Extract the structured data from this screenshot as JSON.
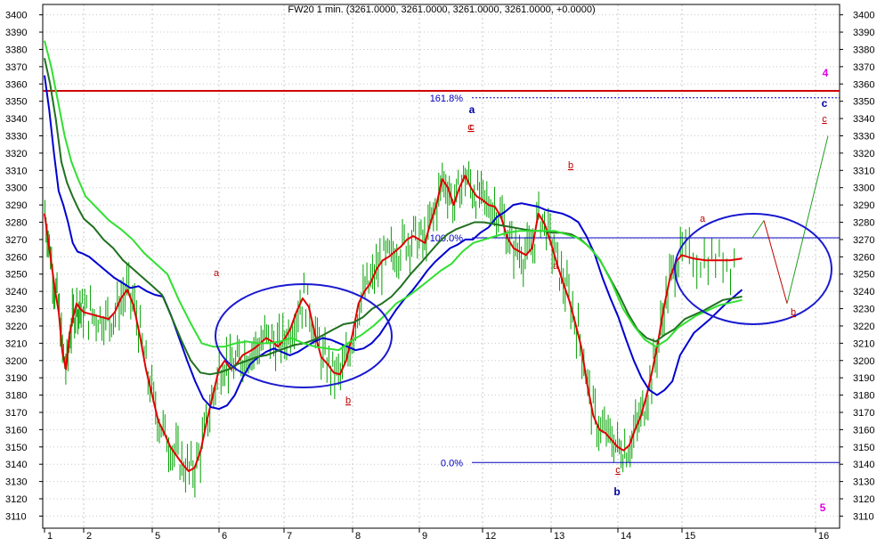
{
  "chart_data": {
    "type": "line",
    "title": "FW20 1 min. (3261.0000, 3261.0000, 3261.0000, 3261.0000, +0.0000)",
    "xlabel": "",
    "ylabel": "",
    "ylim": [
      3103,
      3406
    ],
    "y_ticks": [
      3110,
      3120,
      3130,
      3140,
      3150,
      3160,
      3170,
      3180,
      3190,
      3200,
      3210,
      3220,
      3230,
      3240,
      3250,
      3260,
      3270,
      3280,
      3290,
      3300,
      3310,
      3320,
      3330,
      3340,
      3350,
      3360,
      3370,
      3380,
      3390,
      3400
    ],
    "x_day_ticks": [
      "1",
      "2",
      "5",
      "6",
      "7",
      "8",
      "9",
      "12",
      "13",
      "14",
      "15",
      "16"
    ],
    "grid": true,
    "colors": {
      "price_bars": "#00a000",
      "fast_ma": "#e00000",
      "mid_ma": "#0000d0",
      "slow_ma_dark": "#207020",
      "slow_ma_light": "#30e030",
      "resistance": "#d00000",
      "fib": "#0000c0",
      "wave_red": "#c00000",
      "wave_blue": "#0000a0",
      "wave_magenta": "#e000e0"
    },
    "resistance_level": 3356,
    "fibonacci": [
      {
        "label": "161.8%",
        "value": 3352,
        "style": "dashed"
      },
      {
        "label": "100.0%",
        "value": 3271,
        "style": "solid"
      },
      {
        "label": "0.0%",
        "value": 3141,
        "style": "solid"
      }
    ],
    "series": [
      {
        "values": [
          3285,
          3270,
          3255,
          3240,
          3228,
          3205,
          3195,
          3215,
          3225,
          3233,
          3230,
          3228,
          3227,
          3226,
          3225,
          3224,
          3228,
          3236,
          3241,
          3232,
          3215,
          3195,
          3180,
          3165,
          3158,
          3150,
          3145,
          3140,
          3136,
          3138,
          3148,
          3165,
          3180,
          3195,
          3200,
          3195,
          3198,
          3203,
          3205,
          3207,
          3210,
          3213,
          3211,
          3208,
          3212,
          3218,
          3228,
          3236,
          3231,
          3215,
          3202,
          3198,
          3193,
          3192,
          3200,
          3215,
          3233,
          3240,
          3245,
          3253,
          3258,
          3260,
          3263,
          3266,
          3270,
          3272,
          3270,
          3268,
          3280,
          3290,
          3305,
          3300,
          3290,
          3300,
          3307,
          3300,
          3295,
          3293,
          3290,
          3289,
          3283,
          3271,
          3265,
          3263,
          3261,
          3265,
          3285,
          3279,
          3268,
          3256,
          3245,
          3235,
          3222,
          3208,
          3186,
          3168,
          3160,
          3158,
          3154,
          3150,
          3148,
          3151,
          3160,
          3168,
          3180,
          3195,
          3212,
          3232,
          3248,
          3257,
          3261,
          3259,
          3258,
          3258,
          3258,
          3259
        ]
      },
      {
        "values": [
          3365,
          3345,
          3320,
          3298,
          3290,
          3280,
          3268,
          3263,
          3262,
          3260,
          3256,
          3252,
          3248,
          3245,
          3242,
          3243,
          3240,
          3238,
          3237,
          3226,
          3213,
          3200,
          3188,
          3178,
          3173,
          3172,
          3174,
          3180,
          3190,
          3198,
          3202,
          3205,
          3207,
          3205,
          3203,
          3205,
          3208,
          3211,
          3213,
          3212,
          3210,
          3208,
          3206,
          3207,
          3210,
          3215,
          3222,
          3229,
          3235,
          3240,
          3246,
          3252,
          3257,
          3261,
          3265,
          3267,
          3270,
          3270,
          3274,
          3277,
          3283,
          3286,
          3290,
          3291,
          3290,
          3289,
          3287,
          3286,
          3285,
          3283,
          3280,
          3272,
          3262,
          3248,
          3236,
          3225,
          3212,
          3200,
          3190,
          3183,
          3180,
          3183,
          3188,
          3203,
          3216,
          3224,
          3233,
          3241
        ]
      },
      {
        "values": [
          3375,
          3360,
          3340,
          3315,
          3303,
          3295,
          3288,
          3282,
          3277,
          3270,
          3265,
          3258,
          3253,
          3248,
          3243,
          3238,
          3225,
          3212,
          3200,
          3193,
          3192,
          3193,
          3195,
          3198,
          3200,
          3202,
          3203,
          3205,
          3207,
          3209,
          3210,
          3212,
          3215,
          3218,
          3221,
          3222,
          3225,
          3230,
          3233,
          3237,
          3243,
          3250,
          3256,
          3262,
          3268,
          3273,
          3276,
          3278,
          3280,
          3280,
          3279,
          3278,
          3277,
          3276,
          3275,
          3275,
          3274,
          3274,
          3273,
          3270,
          3265,
          3258,
          3248,
          3238,
          3227,
          3218,
          3213,
          3211,
          3215,
          3218,
          3224,
          3229,
          3235,
          3237
        ]
      },
      {
        "values": [
          3385,
          3370,
          3350,
          3330,
          3315,
          3305,
          3295,
          3288,
          3281,
          3276,
          3270,
          3262,
          3256,
          3250,
          3235,
          3222,
          3210,
          3208,
          3208,
          3210,
          3211,
          3210,
          3210,
          3211,
          3213,
          3210,
          3208,
          3207,
          3206,
          3211,
          3215,
          3220,
          3226,
          3233,
          3237,
          3242,
          3247,
          3252,
          3256,
          3263,
          3268,
          3270,
          3272,
          3274,
          3275,
          3275,
          3275,
          3275,
          3273,
          3271,
          3266,
          3258,
          3245,
          3230,
          3220,
          3212,
          3208,
          3212,
          3219,
          3226,
          3232,
          3235
        ]
      }
    ],
    "forecast_path": [
      3271,
      3281,
      3233,
      3330
    ],
    "wave_labels": [
      {
        "text": "a",
        "color": "red"
      },
      {
        "text": "b",
        "color": "red"
      },
      {
        "text": "c",
        "color": "red"
      },
      {
        "text": "a",
        "color": "blue"
      },
      {
        "text": "c",
        "color": "red"
      },
      {
        "text": "a",
        "color": "red"
      },
      {
        "text": "b",
        "color": "red"
      },
      {
        "text": "c",
        "color": "red"
      },
      {
        "text": "b",
        "color": "blue"
      },
      {
        "text": "a",
        "color": "red"
      },
      {
        "text": "b",
        "color": "red"
      },
      {
        "text": "c",
        "color": "red"
      },
      {
        "text": "c",
        "color": "blue"
      },
      {
        "text": "4",
        "color": "magenta"
      },
      {
        "text": "5",
        "color": "magenta"
      }
    ],
    "annotations": [
      "highlight-ellipse-left",
      "highlight-ellipse-right"
    ]
  }
}
